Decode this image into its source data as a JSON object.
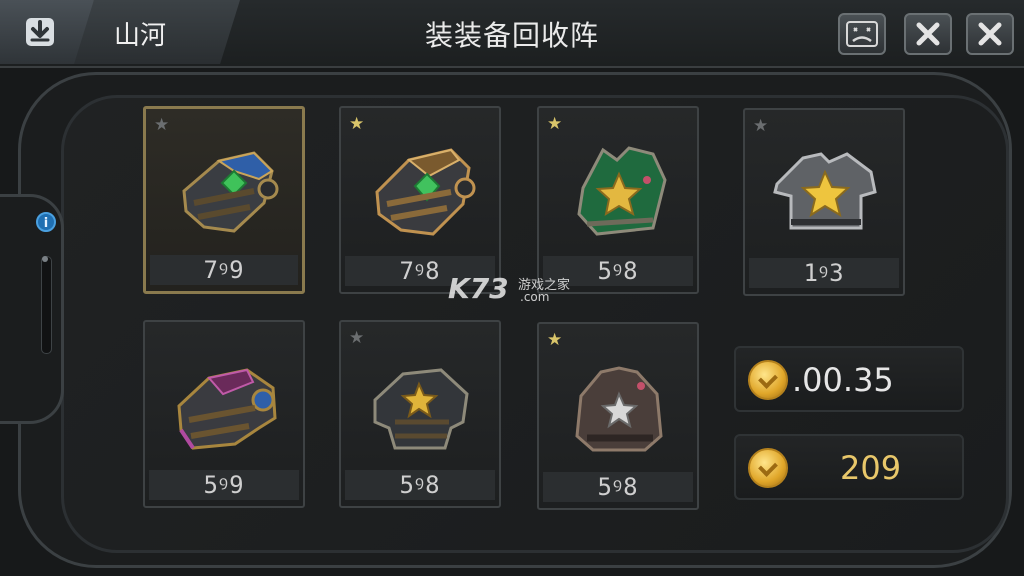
{
  "topbar": {
    "back_icon": "download-arrow-icon",
    "tab_name": "山河",
    "title": "装装备回收阵",
    "buttons": [
      {
        "icon": "face-icon"
      },
      {
        "icon": "close-icon"
      },
      {
        "icon": "close-icon"
      }
    ]
  },
  "side": {
    "info_icon": "info-icon"
  },
  "items": [
    {
      "star": "grey",
      "qty": "7ꝰ9",
      "art": "blue-armor",
      "selected": true
    },
    {
      "star": "gold",
      "qty": "7ꝰ8",
      "art": "bronze-armor"
    },
    {
      "star": "gold",
      "qty": "5ꝰ8",
      "art": "green-star-armor"
    },
    {
      "star": "grey",
      "qty": "1ꝰ3",
      "art": "silver-star-armor"
    },
    {
      "star": "none",
      "qty": "5ꝰ9",
      "art": "purple-armor"
    },
    {
      "star": "grey",
      "qty": "5ꝰ8",
      "art": "dark-star-armor"
    },
    {
      "star": "gold",
      "qty": "5ꝰ8",
      "art": "leather-armor"
    }
  ],
  "currency": [
    {
      "value": ".00.35",
      "color": "#e6e6e6"
    },
    {
      "value": "209",
      "color": "#e8c76a"
    }
  ],
  "watermark": {
    "main": "K73",
    "cn": "游戏之家",
    "domain": ".com"
  },
  "colors": {
    "gold_star": "#d9c56a",
    "selected_border": "#8a7a4e",
    "accent_blue": "#1f6fb2"
  }
}
